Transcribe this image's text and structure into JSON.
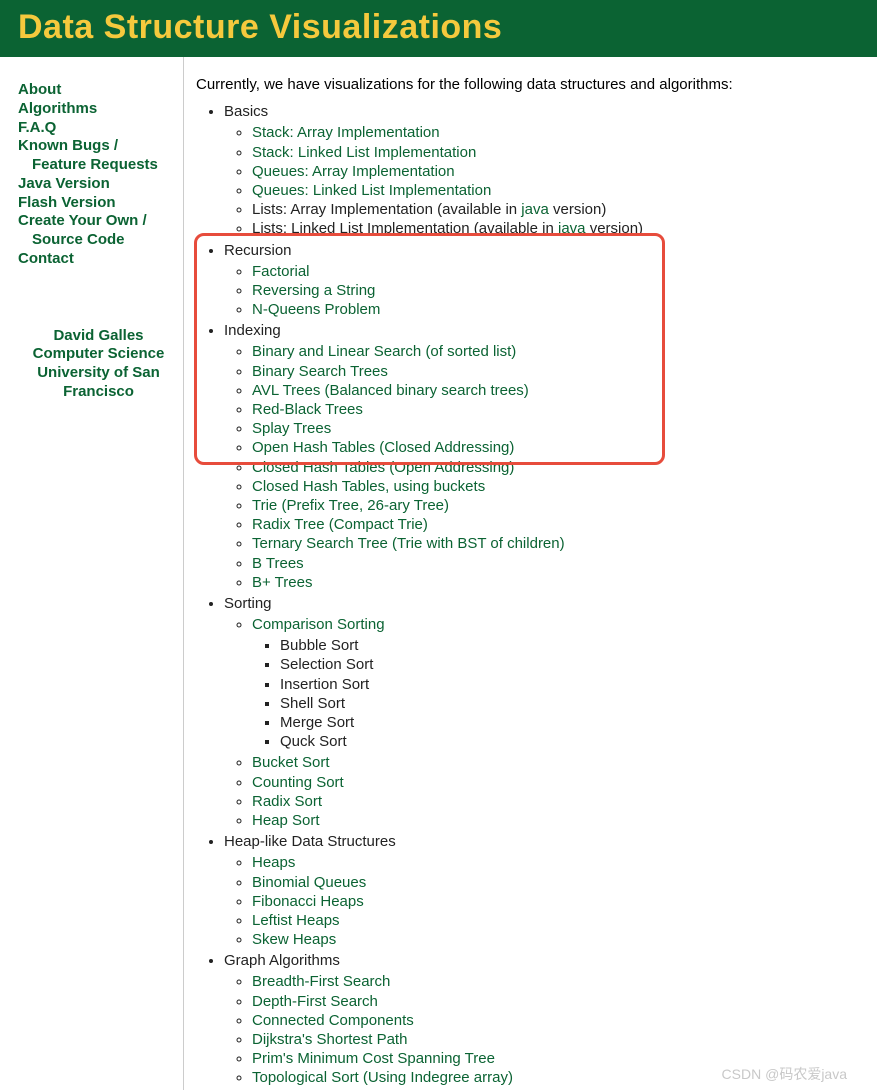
{
  "title": "Data Structure Visualizations",
  "sidebar": {
    "nav": [
      "About",
      "Algorithms",
      "F.A.Q",
      "Known Bugs /",
      "Feature Requests",
      "Java Version",
      "Flash Version",
      "Create Your Own /",
      "Source Code",
      "Contact"
    ],
    "credits": {
      "name": "David Galles",
      "dept": "Computer Science",
      "univ": "University of San Francisco"
    }
  },
  "intro": "Currently, we have visualizations for the following data structures and algorithms:",
  "sections": {
    "basics": {
      "label": "Basics",
      "items": {
        "stack_array": "Stack: Array Implementation",
        "stack_linked": "Stack: Linked List Implementation",
        "queue_array": "Queues: Array Implementation",
        "queue_linked": "Queues: Linked List Implementation",
        "lists_array_prefix": "Lists: Array Implementation (available in ",
        "lists_linked_prefix": "Lists: Linked List Implementation (available in ",
        "java_link": "java",
        "version_suffix": " version)"
      }
    },
    "recursion": {
      "label": "Recursion",
      "items": {
        "factorial": "Factorial",
        "reversing": "Reversing a String",
        "nqueens": "N-Queens Problem"
      }
    },
    "indexing": {
      "label": "Indexing",
      "items": {
        "binsearch": "Binary and Linear Search (of sorted list)",
        "bst": "Binary Search Trees",
        "avl": "AVL Trees (Balanced binary search trees)",
        "redblack": "Red-Black Trees",
        "splay": "Splay Trees",
        "openhash": "Open Hash Tables (Closed Addressing)",
        "closedhash": "Closed Hash Tables (Open Addressing)",
        "closedhash_bucket": "Closed Hash Tables, using buckets",
        "trie": "Trie (Prefix Tree, 26-ary Tree)",
        "radix": "Radix Tree (Compact Trie)",
        "ternary": "Ternary Search Tree (Trie with BST of children)",
        "btree": "B Trees",
        "bplus": "B+ Trees"
      }
    },
    "sorting": {
      "label": "Sorting",
      "comp": {
        "label": "Comparison Sorting",
        "items": {
          "bubble": "Bubble Sort",
          "selection": "Selection Sort",
          "insertion": "Insertion Sort",
          "shell": "Shell Sort",
          "merge": "Merge Sort",
          "quick": "Quck Sort"
        }
      },
      "items": {
        "bucket": "Bucket Sort",
        "counting": "Counting Sort",
        "radix": "Radix Sort",
        "heap": "Heap Sort"
      }
    },
    "heaps": {
      "label": "Heap-like Data Structures",
      "items": {
        "heaps": "Heaps",
        "binomial": "Binomial Queues",
        "fibonacci": "Fibonacci Heaps",
        "leftist": "Leftist Heaps",
        "skew": "Skew Heaps"
      }
    },
    "graph": {
      "label": "Graph Algorithms",
      "items": {
        "bfs": "Breadth-First Search",
        "dfs": "Depth-First Search",
        "cc": "Connected Components",
        "dijkstra": "Dijkstra's Shortest Path",
        "prim": "Prim's Minimum Cost Spanning Tree",
        "topo": "Topological Sort (Using Indegree array)"
      }
    }
  },
  "watermark": "CSDN @码农爱java"
}
